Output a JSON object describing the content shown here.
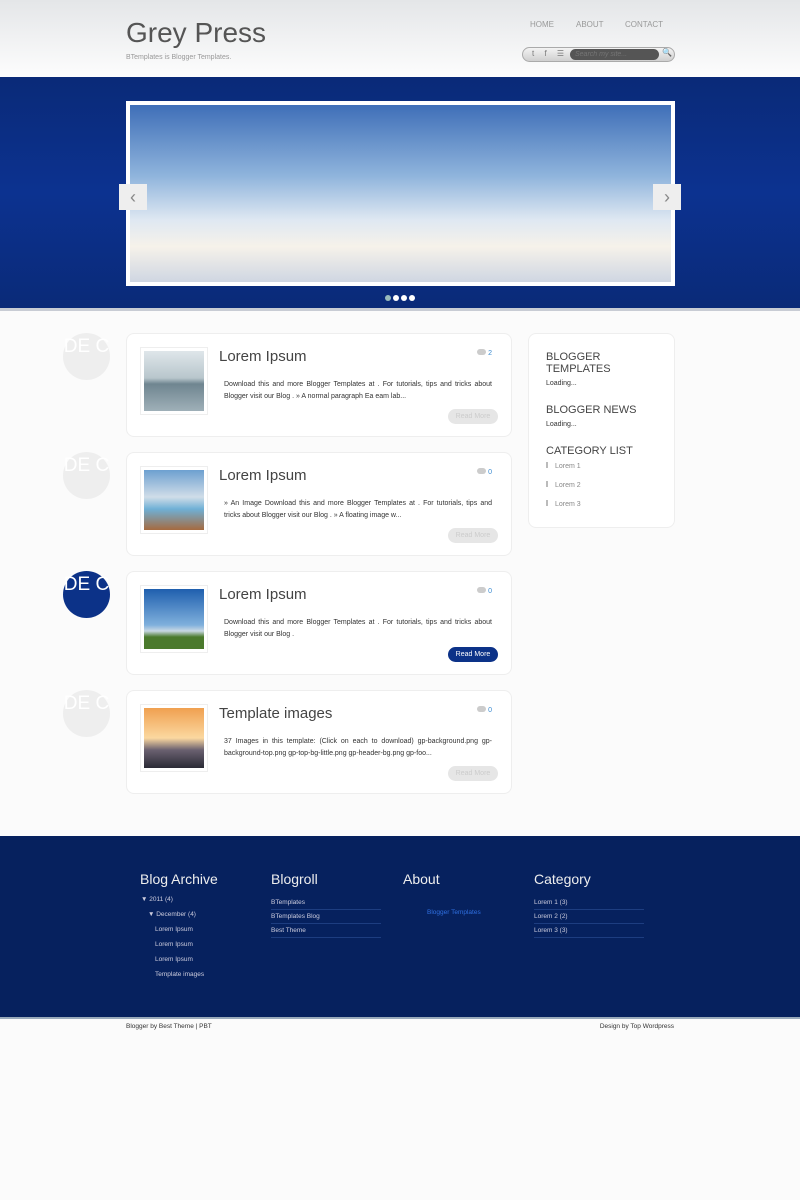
{
  "header": {
    "title": "Grey Press",
    "tagline": "BTemplates is Blogger Templates.",
    "nav": [
      "HOME",
      "ABOUT",
      "CONTACT"
    ],
    "search_placeholder": "Search my site...",
    "social": "t f ☰"
  },
  "slider": {
    "prev": "‹",
    "next": "›",
    "dots": 4,
    "active": 0
  },
  "posts": [
    {
      "date": "DE C",
      "title": "Lorem Ipsum",
      "comments": "2",
      "excerpt": "Download this and more Blogger Templates at . For tutorials, tips and tricks about Blogger visit our Blog . » A normal paragraph Ea eam lab...",
      "read_more": "Read More",
      "active": false
    },
    {
      "date": "DE C",
      "title": "Lorem Ipsum",
      "comments": "0",
      "excerpt": "» An Image Download this and more Blogger Templates at . For tutorials, tips and tricks about Blogger visit our Blog . » A floating image w...",
      "read_more": "Read More",
      "active": false
    },
    {
      "date": "DE C",
      "title": "Lorem Ipsum",
      "comments": "0",
      "excerpt": "Download this and more Blogger Templates at . For tutorials, tips and tricks about Blogger visit our Blog .",
      "read_more": "Read More",
      "active": true
    },
    {
      "date": "DE C",
      "title": "Template images",
      "comments": "0",
      "excerpt": "37 Images in this template: (Click on each to download) gp-background.png gp-background-top.png gp-top-bg-little.png gp-header-bg.png gp-foo...",
      "read_more": "Read More",
      "active": false
    }
  ],
  "sidebar": {
    "templates_title": "BLOGGER TEMPLATES",
    "templates_loading": "Loading...",
    "news_title": "BLOGGER NEWS",
    "news_loading": "Loading...",
    "category_title": "CATEGORY LIST",
    "categories": [
      "Lorem 1",
      "Lorem 2",
      "Lorem 3"
    ]
  },
  "footer": {
    "archive": {
      "title": "Blog Archive",
      "year": "▼  2011 (4)",
      "month": "▼  December (4)",
      "items": [
        "Lorem Ipsum",
        "Lorem Ipsum",
        "Lorem Ipsum",
        "Template images"
      ]
    },
    "blogroll": {
      "title": "Blogroll",
      "items": [
        "BTemplates",
        "BTemplates Blog",
        "Best Theme"
      ]
    },
    "about": {
      "title": "About",
      "link": "Blogger Templates"
    },
    "category": {
      "title": "Category",
      "items": [
        "Lorem 1 (3)",
        "Lorem 2 (2)",
        "Lorem 3 (3)"
      ]
    }
  },
  "bottom": {
    "left": "Blogger by Best Theme | PBT",
    "right": "Design by Top Wordpress"
  },
  "colors": {
    "brand_blue": "#0c3288",
    "footer_blue": "#06215e"
  }
}
